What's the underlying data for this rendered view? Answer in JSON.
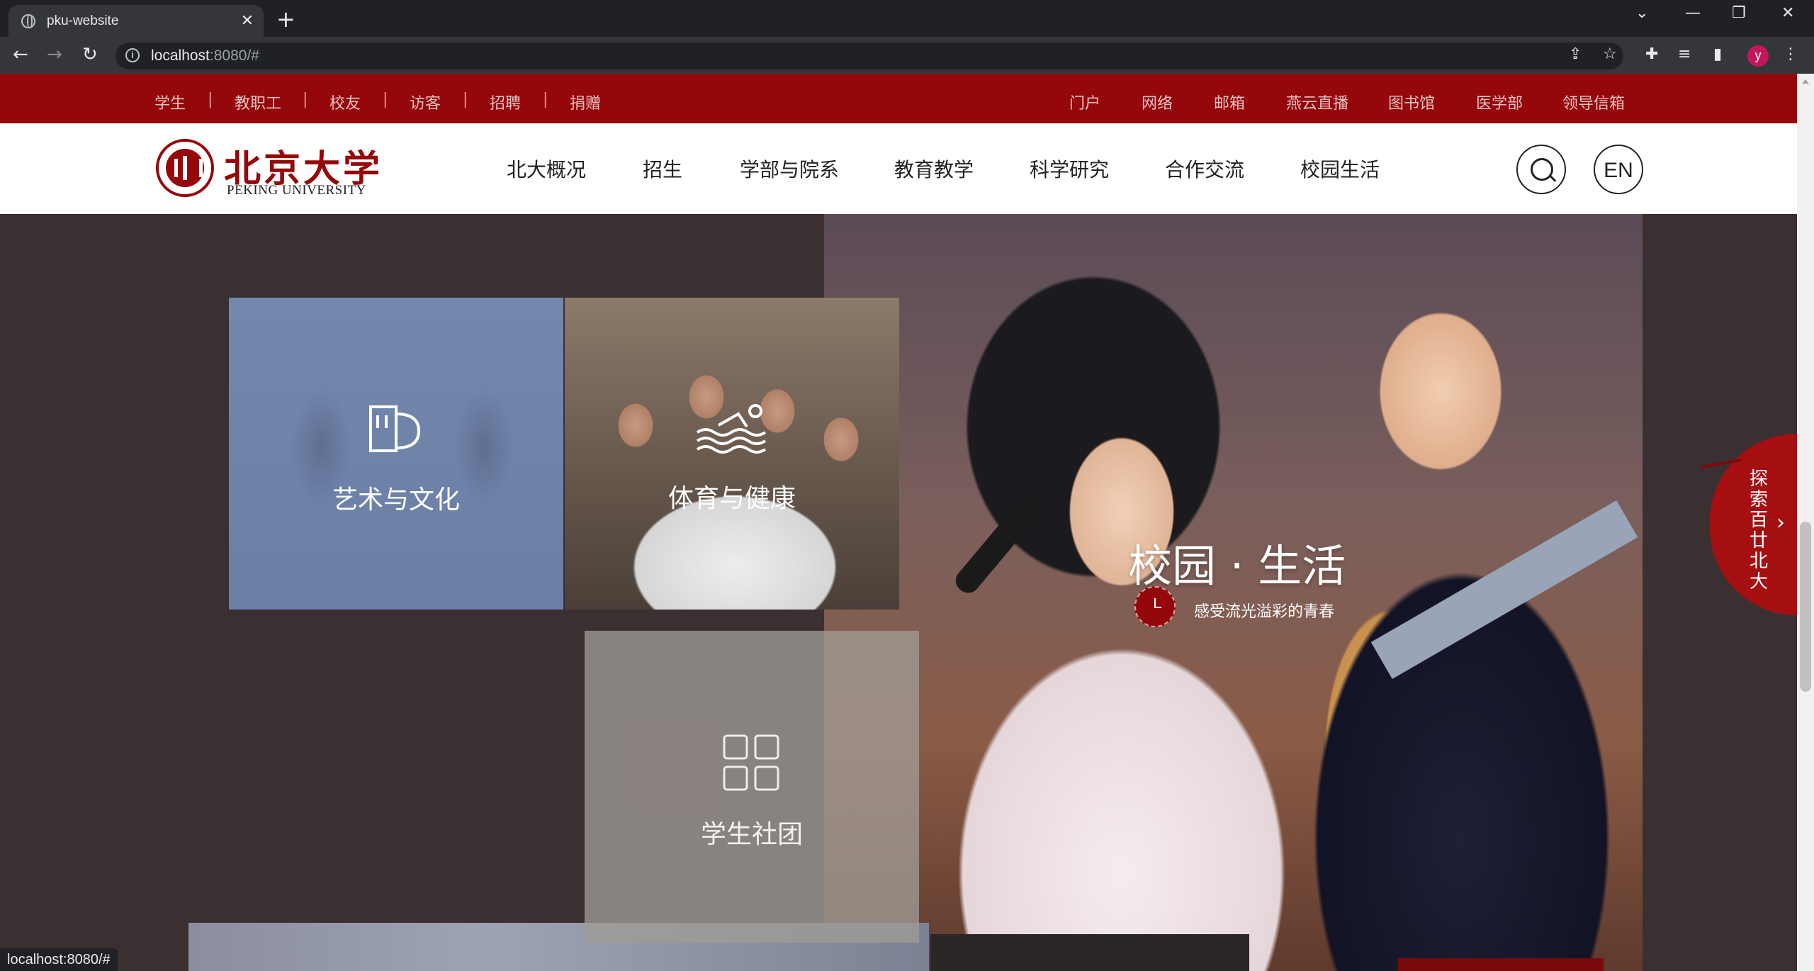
{
  "browser": {
    "tab_title": "pku-website",
    "url_host": "localhost",
    "url_rest": ":8080/#",
    "profile_initial": "y",
    "status_url": "localhost:8080/#"
  },
  "topbar": {
    "left_links": [
      "学生",
      "教职工",
      "校友",
      "访客",
      "招聘",
      "捐赠"
    ],
    "separator": "|",
    "right_links": [
      "门户",
      "网络",
      "邮箱",
      "燕云直播",
      "图书馆",
      "医学部",
      "领导信箱"
    ]
  },
  "header": {
    "logo_cn": "北京大学",
    "logo_en": "PEKING UNIVERSITY",
    "nav": [
      "北大概况",
      "招生",
      "学部与院系",
      "教育教学",
      "科学研究",
      "合作交流",
      "校园生活"
    ],
    "lang_button": "EN"
  },
  "hero": {
    "title": "校园 · 生活",
    "subtitle": "感受流光溢彩的青春",
    "tiles": [
      {
        "label": "艺术与文化",
        "icon": "theater-mask-icon"
      },
      {
        "label": "体育与健康",
        "icon": "swimmer-icon"
      },
      {
        "label": "学生社团",
        "icon": "grid-icon"
      }
    ],
    "explore_text": "探索百廿北大"
  },
  "colors": {
    "brand_red": "#94070a",
    "page_bg": "#3a2f31"
  }
}
